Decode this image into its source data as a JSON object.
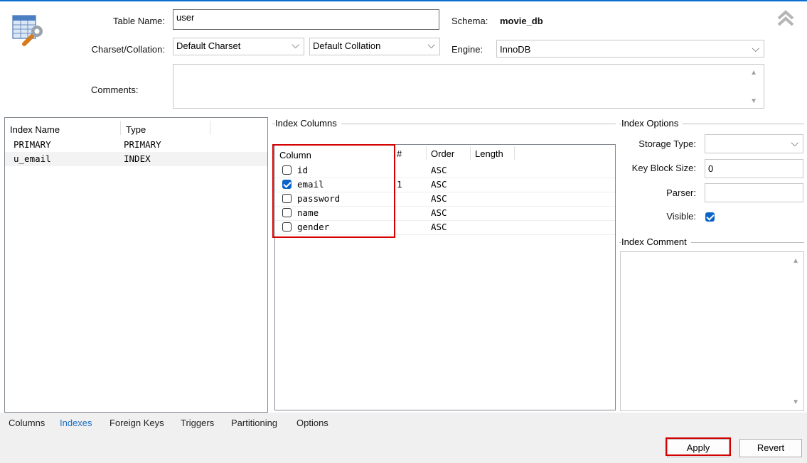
{
  "header": {
    "table_name_label": "Table Name:",
    "table_name_value": "user",
    "schema_label": "Schema:",
    "schema_value": "movie_db",
    "charset_label": "Charset/Collation:",
    "charset_value": "Default Charset",
    "collation_value": "Default Collation",
    "engine_label": "Engine:",
    "engine_value": "InnoDB",
    "comments_label": "Comments:",
    "comments_value": ""
  },
  "index_list": {
    "headers": [
      "Index Name",
      "Type"
    ],
    "rows": [
      {
        "name": "PRIMARY",
        "type": "PRIMARY"
      },
      {
        "name": "u_email",
        "type": "INDEX"
      }
    ]
  },
  "index_columns": {
    "title": "Index Columns",
    "headers": [
      "Column",
      "#",
      "Order",
      "Length"
    ],
    "rows": [
      {
        "column": "id",
        "checked": false,
        "num": "",
        "order": "ASC",
        "length": ""
      },
      {
        "column": "email",
        "checked": true,
        "num": "1",
        "order": "ASC",
        "length": ""
      },
      {
        "column": "password",
        "checked": false,
        "num": "",
        "order": "ASC",
        "length": ""
      },
      {
        "column": "name",
        "checked": false,
        "num": "",
        "order": "ASC",
        "length": ""
      },
      {
        "column": "gender",
        "checked": false,
        "num": "",
        "order": "ASC",
        "length": ""
      }
    ]
  },
  "index_options": {
    "title": "Index Options",
    "storage_type_label": "Storage Type:",
    "storage_type_value": "",
    "key_block_size_label": "Key Block Size:",
    "key_block_size_value": "0",
    "parser_label": "Parser:",
    "parser_value": "",
    "visible_label": "Visible:",
    "visible_checked": true,
    "comment_title": "Index Comment",
    "comment_value": ""
  },
  "tabs": [
    {
      "label": "Columns",
      "active": false
    },
    {
      "label": "Indexes",
      "active": true
    },
    {
      "label": "Foreign Keys",
      "active": false
    },
    {
      "label": "Triggers",
      "active": false
    },
    {
      "label": "Partitioning",
      "active": false
    },
    {
      "label": "Options",
      "active": false
    }
  ],
  "footer": {
    "apply_label": "Apply",
    "revert_label": "Revert"
  },
  "colors": {
    "accent": "#0a63c9",
    "active_tab": "#1f6fbf",
    "highlight_box": "#d40000"
  },
  "icons": {
    "table": "table-wrench-icon",
    "collapse": "double-chevron-up-icon"
  }
}
